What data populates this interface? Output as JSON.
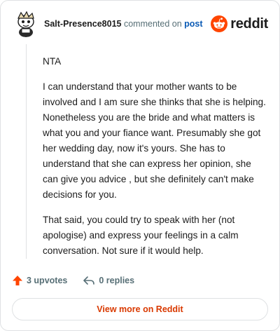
{
  "comment": {
    "author": "Salt-Presence8015",
    "action_text": "commented on",
    "post_link": "post",
    "paragraphs": [
      "NTA",
      "I can understand that your mother wants to be involved and I am sure she thinks that she is helping. Nonetheless you are the bride and what matters is what you and your fiance want. Presumably she got her wedding day, now it's yours. She has to understand that she can express her opinion, she can give you advice , but she definitely can't make decisions for you.",
      "That said, you could try to speak with her (not apologise) and express your feelings in a calm conversation. Not sure if it would help."
    ]
  },
  "brand": {
    "name": "reddit",
    "icon": "reddit-logo-icon",
    "color": "#ff4500"
  },
  "actions": {
    "upvotes": "3 upvotes",
    "upvote_icon": "upvote-arrow-icon",
    "replies": "0 replies",
    "reply_icon": "reply-arrow-icon"
  },
  "footer": {
    "view_more": "View more on Reddit"
  },
  "colors": {
    "accent": "#d93900",
    "upvote": "#ff4500",
    "link": "#0b5bb5",
    "muted": "#576f76"
  }
}
